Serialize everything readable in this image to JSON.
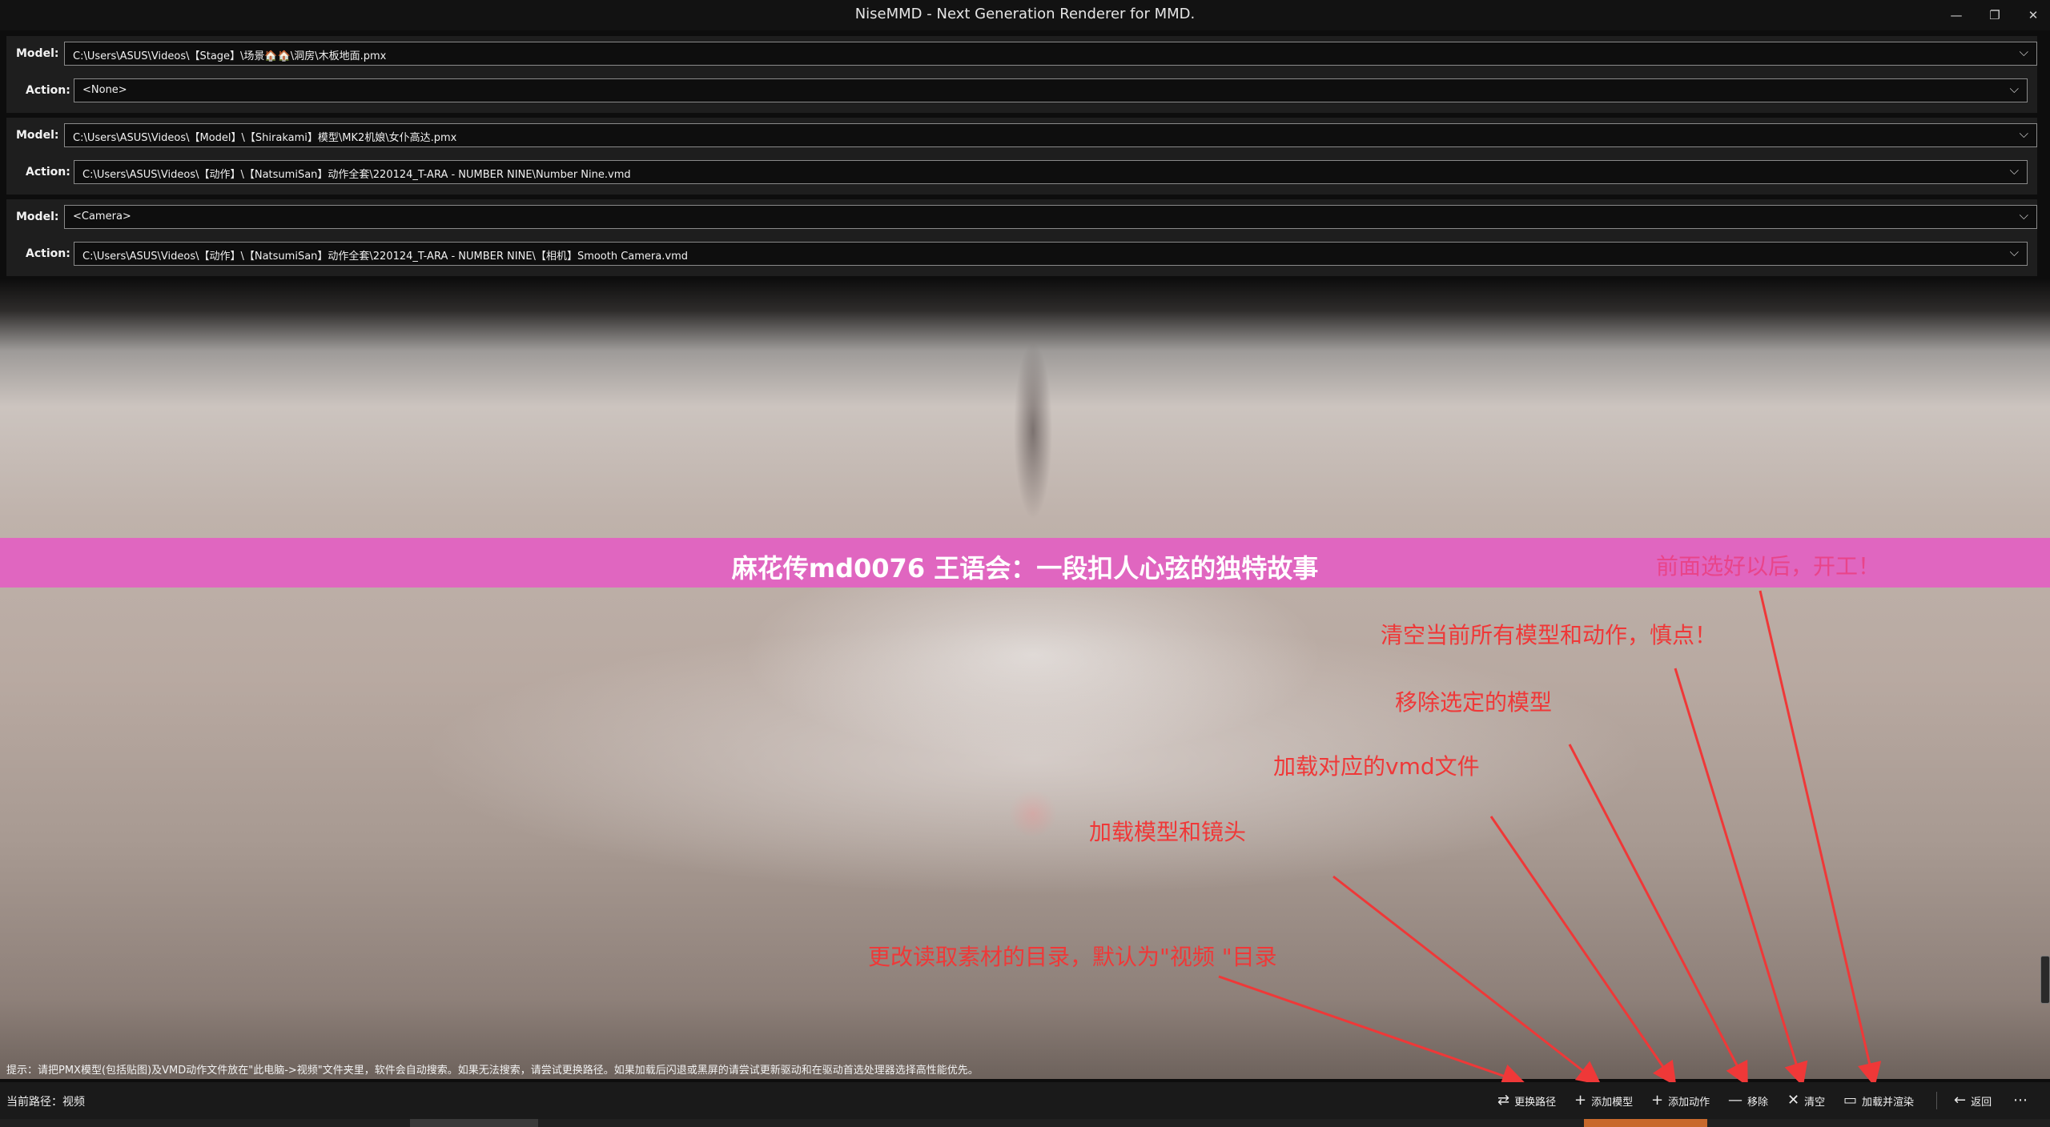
{
  "window": {
    "title": "NiseMMD - Next Generation Renderer for MMD.",
    "minimize_glyph": "—",
    "maximize_glyph": "❐",
    "close_glyph": "✕"
  },
  "groups": [
    {
      "model_label": "Model:",
      "model_value": "C:\\Users\\ASUS\\Videos\\【Stage】\\场景🏠🏠\\洞房\\木板地面.pmx",
      "action_label": "Action:",
      "action_value": "<None>"
    },
    {
      "model_label": "Model:",
      "model_value": "C:\\Users\\ASUS\\Videos\\【Model】\\【Shirakami】模型\\MK2机娘\\女仆高达.pmx",
      "action_label": "Action:",
      "action_value": "C:\\Users\\ASUS\\Videos\\【动作】\\【NatsumiSan】动作全套\\220124_T-ARA - NUMBER NINE\\Number Nine.vmd"
    },
    {
      "model_label": "Model:",
      "model_value": "<Camera>",
      "action_label": "Action:",
      "action_value": "C:\\Users\\ASUS\\Videos\\【动作】\\【NatsumiSan】动作全套\\220124_T-ARA - NUMBER NINE\\【相机】Smooth Camera.vmd"
    }
  ],
  "banner": {
    "title": "麻花传md0076 王语会：一段扣人心弦的独特故事",
    "color": "#e066c0"
  },
  "annotations": {
    "start": "前面选好以后，开工！",
    "clear": "清空当前所有模型和动作，慎点！",
    "remove": "移除选定的模型",
    "add_action": "加载对应的vmd文件",
    "add_model": "加载模型和镜头",
    "change_path": "更改读取素材的目录，默认为\"视频 \"目录",
    "color": "#ef3838"
  },
  "hint": "提示：请把PMX模型(包括贴图)及VMD动作文件放在\"此电脑->视频\"文件夹里，软件会自动搜索。如果无法搜索，请尝试更换路径。如果加载后闪退或黑屏的请尝试更新驱动和在驱动首选处理器选择高性能优先。",
  "bottom_bar": {
    "current_path": "当前路径：视频",
    "buttons": {
      "change_path": {
        "label": "更换路径",
        "icon": "⇄"
      },
      "add_model": {
        "label": "添加模型",
        "icon": "+"
      },
      "add_action": {
        "label": "添加动作",
        "icon": "+"
      },
      "remove": {
        "label": "移除",
        "icon": "—"
      },
      "clear": {
        "label": "清空",
        "icon": "✕"
      },
      "render": {
        "label": "加载并渲染",
        "icon": "▭"
      },
      "back": {
        "label": "返回",
        "icon": "←"
      },
      "more": {
        "label": "",
        "icon": "⋯"
      }
    }
  }
}
